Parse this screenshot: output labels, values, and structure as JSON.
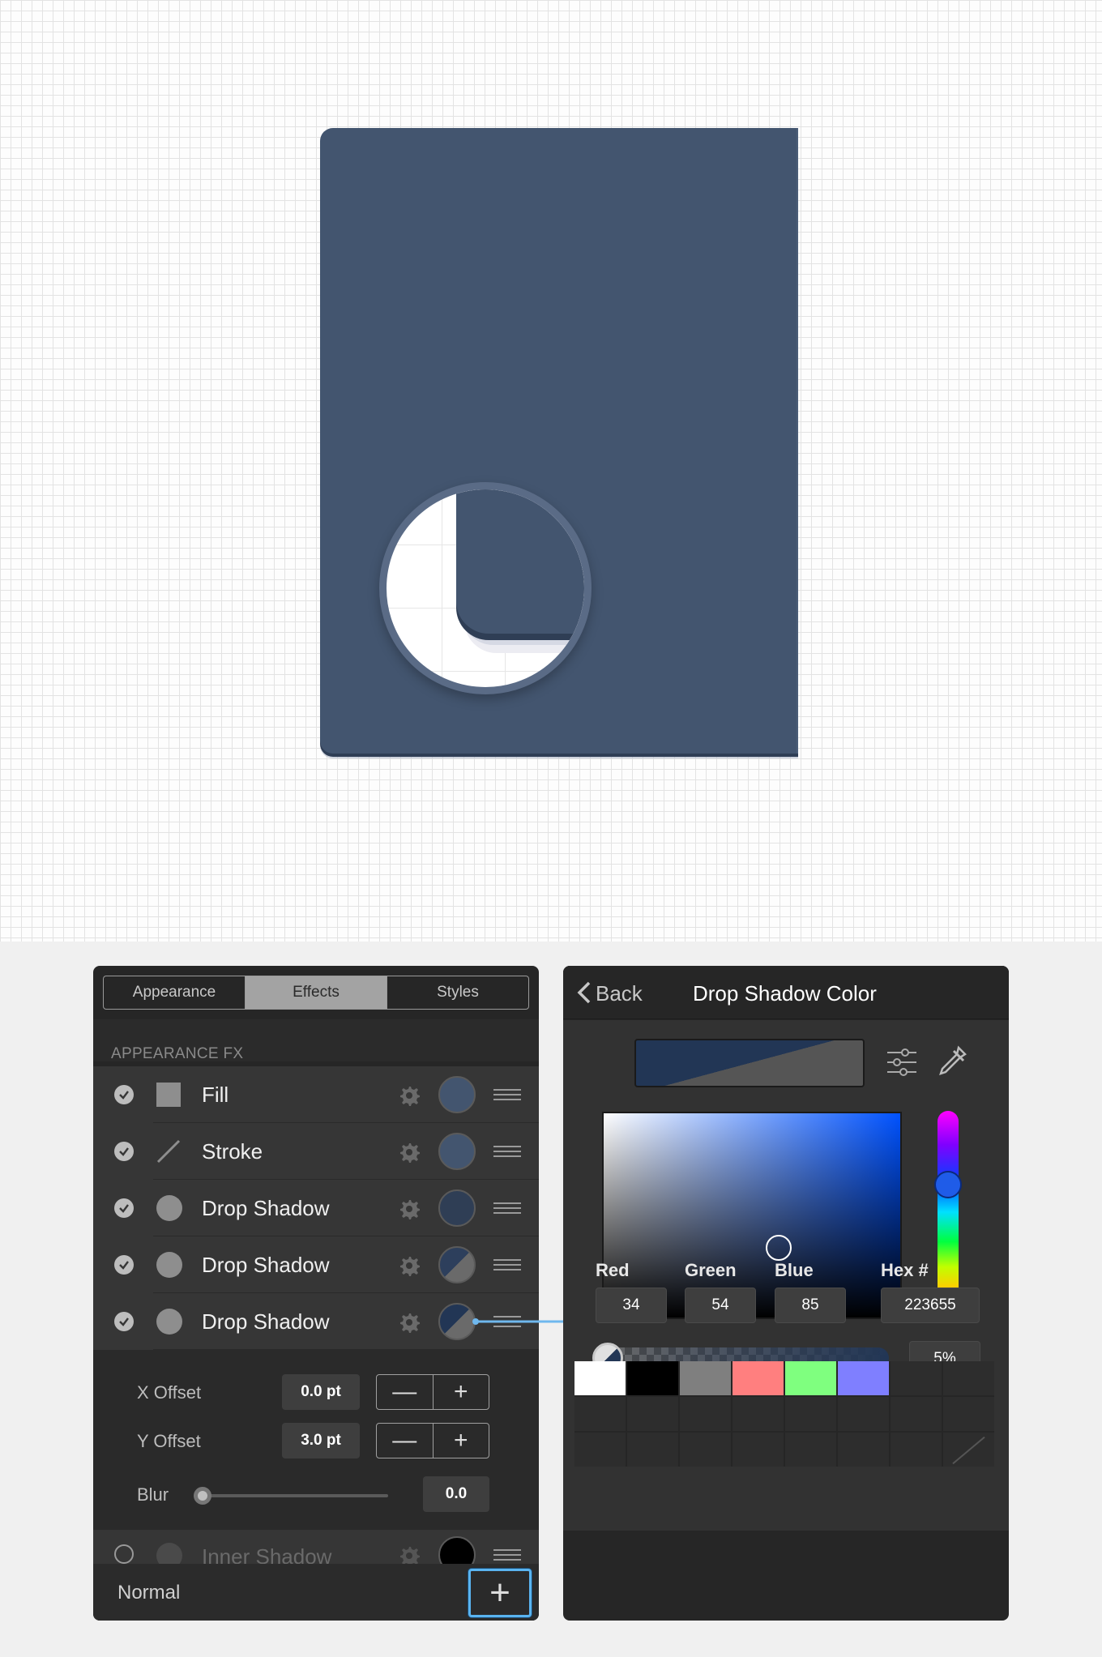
{
  "effects_panel": {
    "tabs": [
      "Appearance",
      "Effects",
      "Styles"
    ],
    "active_tab": "Effects",
    "section_title": "APPEARANCE FX",
    "rows": [
      {
        "label": "Fill",
        "enabled": true,
        "icon": "fill-square-icon",
        "swatch": "#43556f"
      },
      {
        "label": "Stroke",
        "enabled": true,
        "icon": "stroke-line-icon",
        "swatch": "#43556f"
      },
      {
        "label": "Drop Shadow",
        "enabled": true,
        "icon": "drop-shadow-icon",
        "swatch": "#2f3e55"
      },
      {
        "label": "Drop Shadow",
        "enabled": true,
        "icon": "drop-shadow-icon",
        "swatch": "split"
      },
      {
        "label": "Drop Shadow",
        "enabled": true,
        "icon": "drop-shadow-icon",
        "swatch": "split"
      }
    ],
    "detail": {
      "x_offset_label": "X Offset",
      "x_offset_value": "0.0 pt",
      "y_offset_label": "Y Offset",
      "y_offset_value": "3.0 pt",
      "blur_label": "Blur",
      "blur_value": "0.0",
      "minus": "—",
      "plus": "+"
    },
    "inner_shadow": {
      "label": "Inner Shadow",
      "enabled": false
    },
    "blend_mode": "Normal",
    "add_label": "+"
  },
  "color_panel": {
    "back_label": "Back",
    "title": "Drop Shadow Color",
    "preview_color": "#223655",
    "labels": {
      "red": "Red",
      "green": "Green",
      "blue": "Blue",
      "hex": "Hex #"
    },
    "values": {
      "red": "34",
      "green": "54",
      "blue": "85",
      "hex": "223655"
    },
    "alpha": "5%",
    "swatches": [
      "#ffffff",
      "#000000",
      "#7f7f7f",
      "#ff7f7f",
      "#7fff7f",
      "#7f7fff"
    ]
  },
  "colors": {
    "card": "#43556f",
    "accent": "#5ab4f0"
  }
}
